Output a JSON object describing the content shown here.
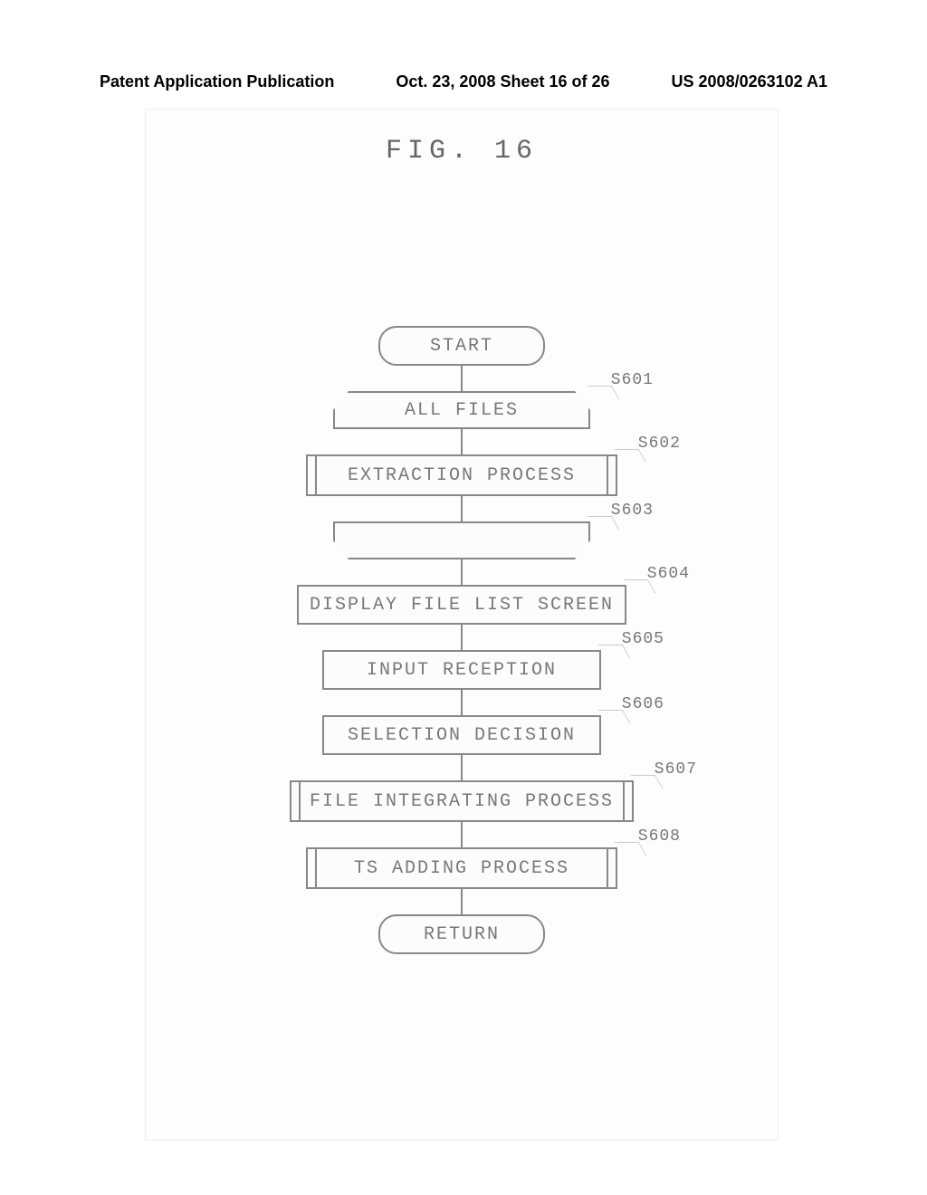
{
  "header": {
    "left": "Patent Application Publication",
    "middle": "Oct. 23, 2008  Sheet 16 of 26",
    "right": "US 2008/0263102 A1"
  },
  "figure": {
    "title": "FIG. 16"
  },
  "flowchart": {
    "start": "START",
    "steps": [
      {
        "id": "S601",
        "type": "manual",
        "text": "ALL FILES"
      },
      {
        "id": "S602",
        "type": "predefined",
        "text": "EXTRACTION PROCESS"
      },
      {
        "id": "S603",
        "type": "manual-end",
        "text": ""
      },
      {
        "id": "S604",
        "type": "process",
        "text": "DISPLAY FILE LIST SCREEN"
      },
      {
        "id": "S605",
        "type": "process",
        "text": "INPUT RECEPTION"
      },
      {
        "id": "S606",
        "type": "process",
        "text": "SELECTION DECISION"
      },
      {
        "id": "S607",
        "type": "predefined",
        "text": "FILE INTEGRATING PROCESS"
      },
      {
        "id": "S608",
        "type": "predefined",
        "text": "TS ADDING PROCESS"
      }
    ],
    "end": "RETURN"
  }
}
